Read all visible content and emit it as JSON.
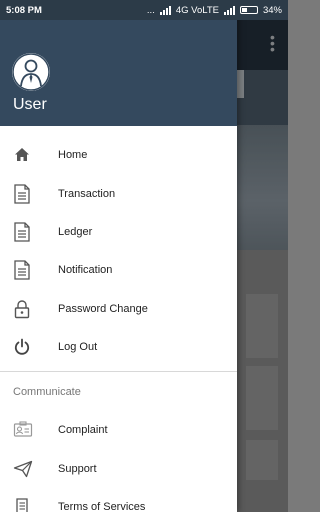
{
  "status_bar": {
    "time": "5:08 PM",
    "dots": "...",
    "network": "4G VoLTE",
    "battery": "34%"
  },
  "drawer": {
    "user_name": "User",
    "menu": [
      {
        "label": "Home",
        "icon": "home-icon"
      },
      {
        "label": "Transaction",
        "icon": "document-icon"
      },
      {
        "label": "Ledger",
        "icon": "document-icon"
      },
      {
        "label": "Notification",
        "icon": "document-icon"
      },
      {
        "label": "Password Change",
        "icon": "lock-icon"
      },
      {
        "label": "Log Out",
        "icon": "power-icon"
      }
    ],
    "section_label": "Communicate",
    "communicate": [
      {
        "label": "Complaint",
        "icon": "id-card-icon"
      },
      {
        "label": "Support",
        "icon": "send-icon"
      },
      {
        "label": "Terms of Services",
        "icon": "scroll-icon"
      }
    ]
  },
  "colors": {
    "header": "#34495e",
    "status_bar": "#2c3b48",
    "drawer_bg": "#ffffff",
    "icon": "#555555"
  }
}
